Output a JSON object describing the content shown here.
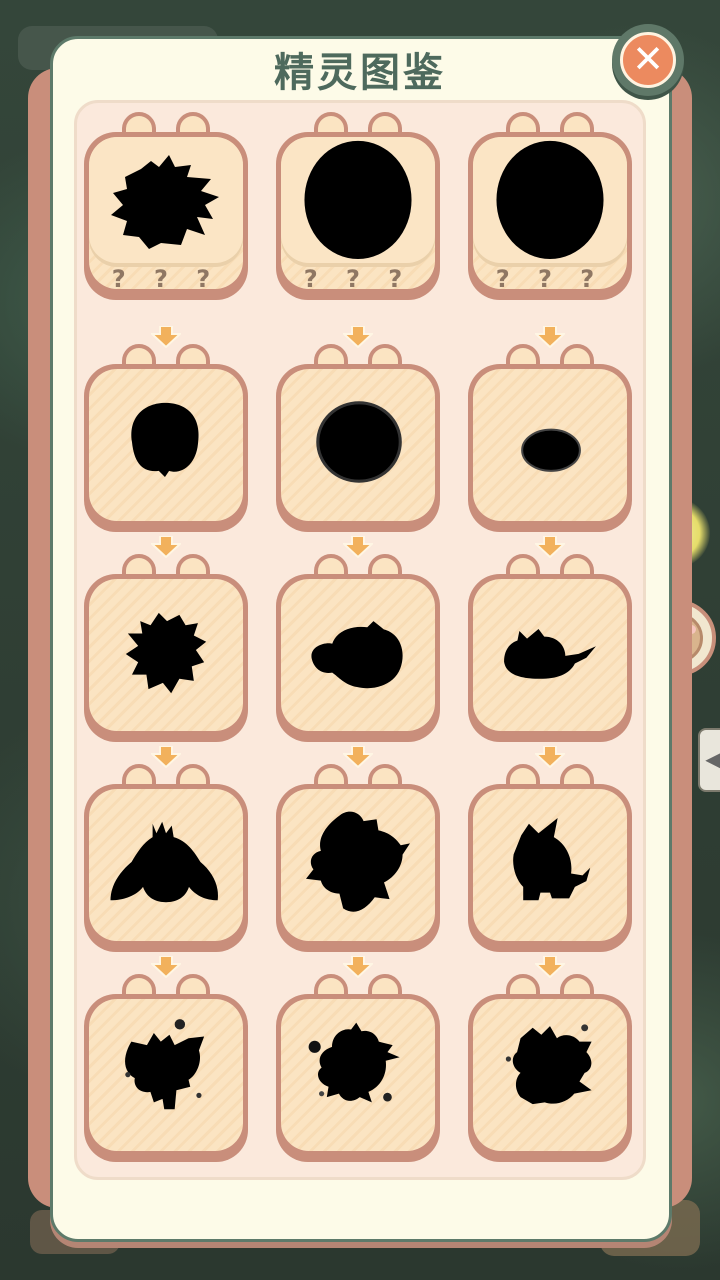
{
  "panel": {
    "title": "精灵图鉴",
    "close_icon": "close-icon"
  },
  "cards": [
    {
      "label": "? ? ?",
      "shape": "sprite-silhouette-0"
    },
    {
      "label": "? ? ?",
      "shape": "sprite-silhouette-1"
    },
    {
      "label": "? ? ?",
      "shape": "sprite-silhouette-2"
    },
    {
      "label": "",
      "shape": "sprite-silhouette-3"
    },
    {
      "label": "",
      "shape": "sprite-silhouette-4"
    },
    {
      "label": "",
      "shape": "sprite-silhouette-5"
    },
    {
      "label": "",
      "shape": "sprite-silhouette-6"
    },
    {
      "label": "",
      "shape": "sprite-silhouette-7"
    },
    {
      "label": "",
      "shape": "sprite-silhouette-8"
    },
    {
      "label": "",
      "shape": "sprite-silhouette-9"
    },
    {
      "label": "",
      "shape": "sprite-silhouette-10"
    },
    {
      "label": "",
      "shape": "sprite-silhouette-11"
    },
    {
      "label": "",
      "shape": "sprite-silhouette-12"
    },
    {
      "label": "",
      "shape": "sprite-silhouette-13"
    },
    {
      "label": "",
      "shape": "sprite-silhouette-14"
    }
  ],
  "side": {
    "paw_icon": "paw-icon",
    "arrow_icon": "chevron-left-icon",
    "arrow_glyph": "◀"
  },
  "colors": {
    "card_border": "#c98e7b",
    "card_fill": "#fbe4c2",
    "title": "#4e6a5d",
    "close": "#ec8a5f",
    "arrow": "#f2b15c"
  }
}
